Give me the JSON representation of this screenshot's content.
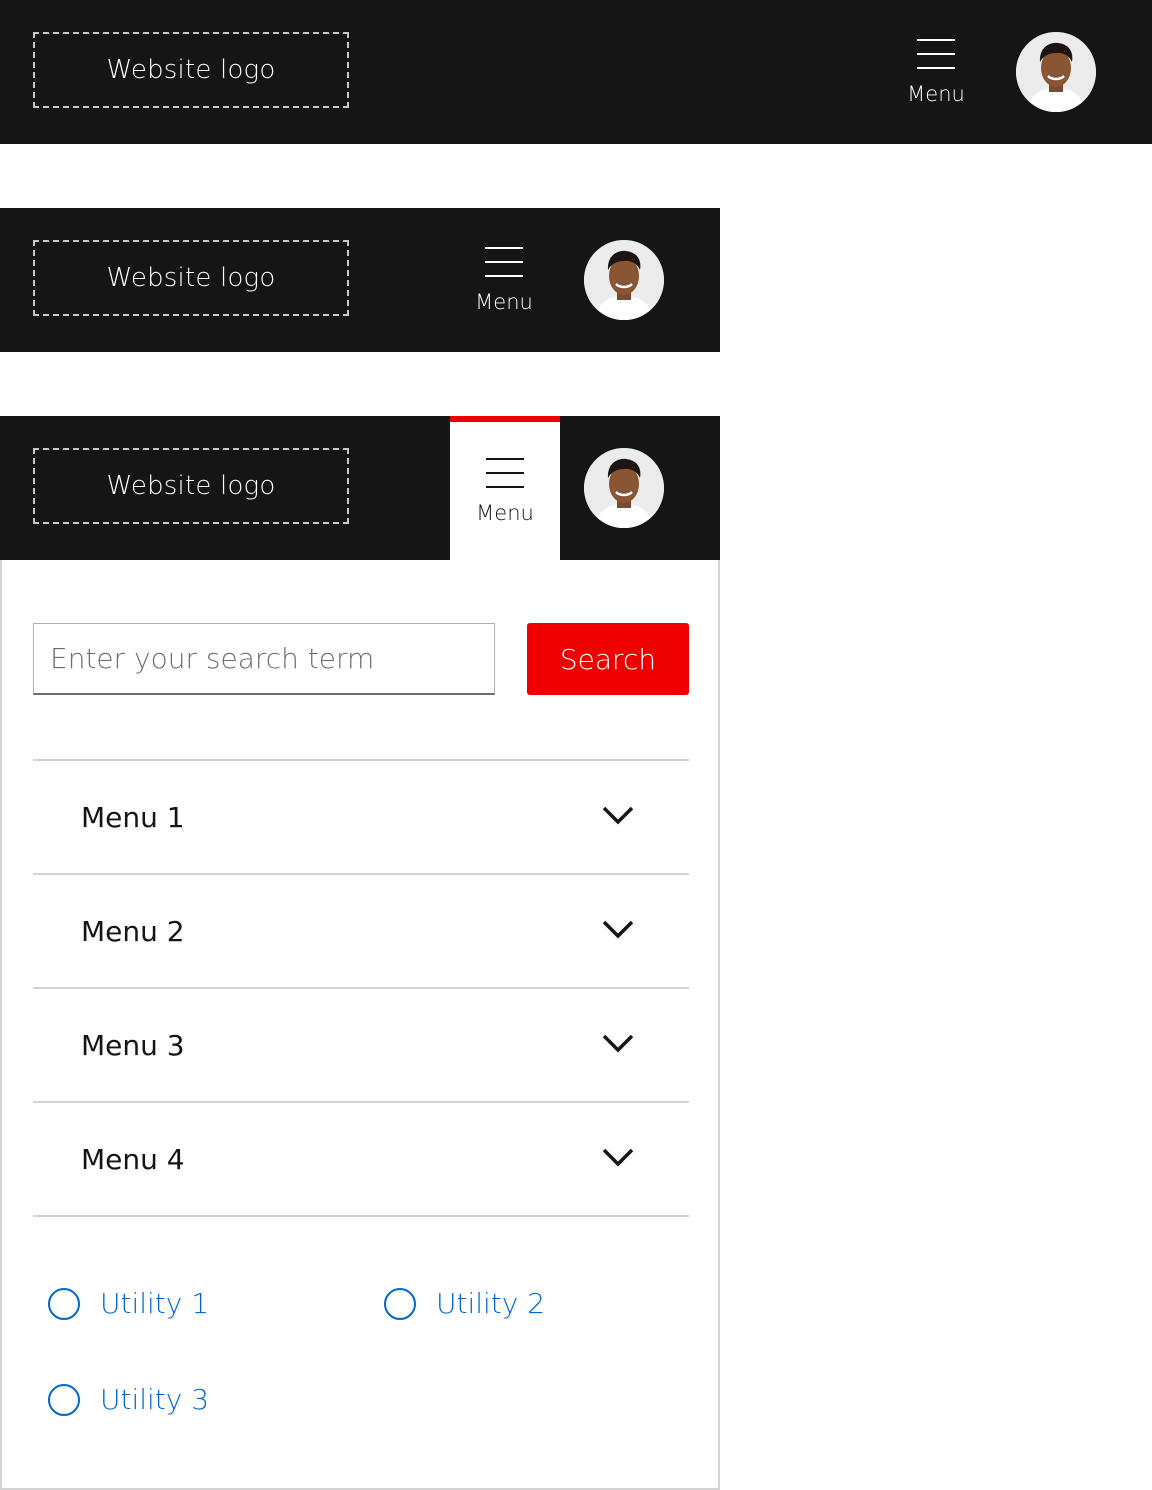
{
  "logo_text": "Website logo",
  "menu_label": "Menu",
  "search": {
    "placeholder": "Enter your search term",
    "button_label": "Search"
  },
  "menus": [
    "Menu 1",
    "Menu 2",
    "Menu 3",
    "Menu 4"
  ],
  "utilities": [
    "Utility 1",
    "Utility 2",
    "Utility 3"
  ],
  "colors": {
    "header_bg": "#151515",
    "accent_red": "#ee0000",
    "link_blue": "#0066cc"
  },
  "icons": {
    "menu": "hamburger-icon",
    "menu_item": "chevron-down-icon",
    "utility": "circle-icon",
    "avatar": "user-avatar"
  }
}
